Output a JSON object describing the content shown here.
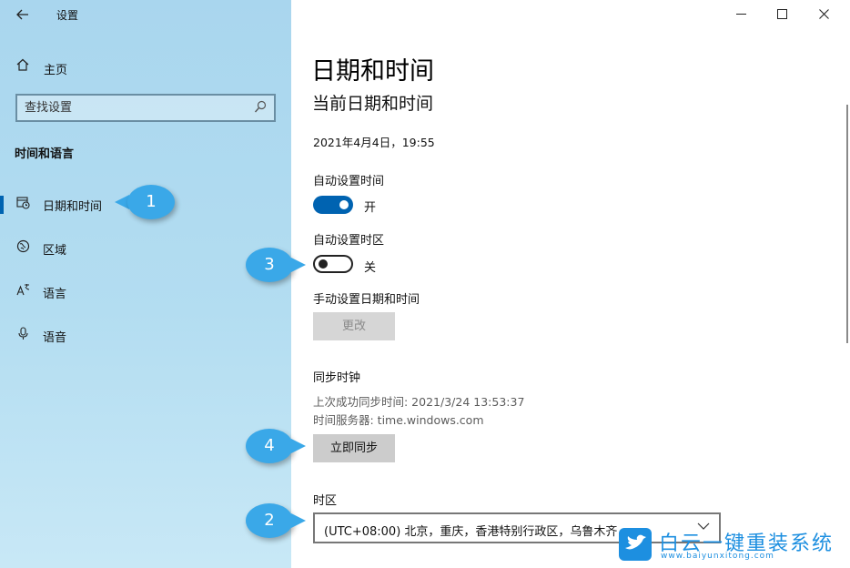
{
  "window": {
    "title": "设置",
    "controls": {
      "minimize": "—",
      "maximize": "☐",
      "close": "✕"
    }
  },
  "sidebar": {
    "home_label": "主页",
    "search_placeholder": "查找设置",
    "section_title": "时间和语言",
    "items": [
      {
        "label": "日期和时间",
        "icon": "calendar-clock-icon",
        "selected": true
      },
      {
        "label": "区域",
        "icon": "globe-icon",
        "selected": false
      },
      {
        "label": "语言",
        "icon": "language-icon",
        "selected": false
      },
      {
        "label": "语音",
        "icon": "microphone-icon",
        "selected": false
      }
    ]
  },
  "main": {
    "page_title": "日期和时间",
    "subtitle": "当前日期和时间",
    "current_datetime": "2021年4月4日，19:55",
    "auto_time": {
      "label": "自动设置时间",
      "state": "开",
      "on": true
    },
    "auto_timezone": {
      "label": "自动设置时区",
      "state": "关",
      "on": false
    },
    "manual": {
      "label": "手动设置日期和时间",
      "button": "更改"
    },
    "sync": {
      "title": "同步时钟",
      "last_sync": "上次成功同步时间: 2021/3/24 13:53:37",
      "server": "时间服务器: time.windows.com",
      "button": "立即同步"
    },
    "timezone": {
      "label": "时区",
      "value": "(UTC+08:00) 北京，重庆，香港特别行政区，乌鲁木齐"
    }
  },
  "callouts": [
    "1",
    "2",
    "3",
    "4"
  ],
  "watermark": {
    "brand": "白云一键重装系统",
    "url": "www.baiyunxitong.com"
  },
  "colors": {
    "accent": "#0063b1",
    "callout": "#3aa8e8",
    "watermark": "#1d8fe0"
  }
}
